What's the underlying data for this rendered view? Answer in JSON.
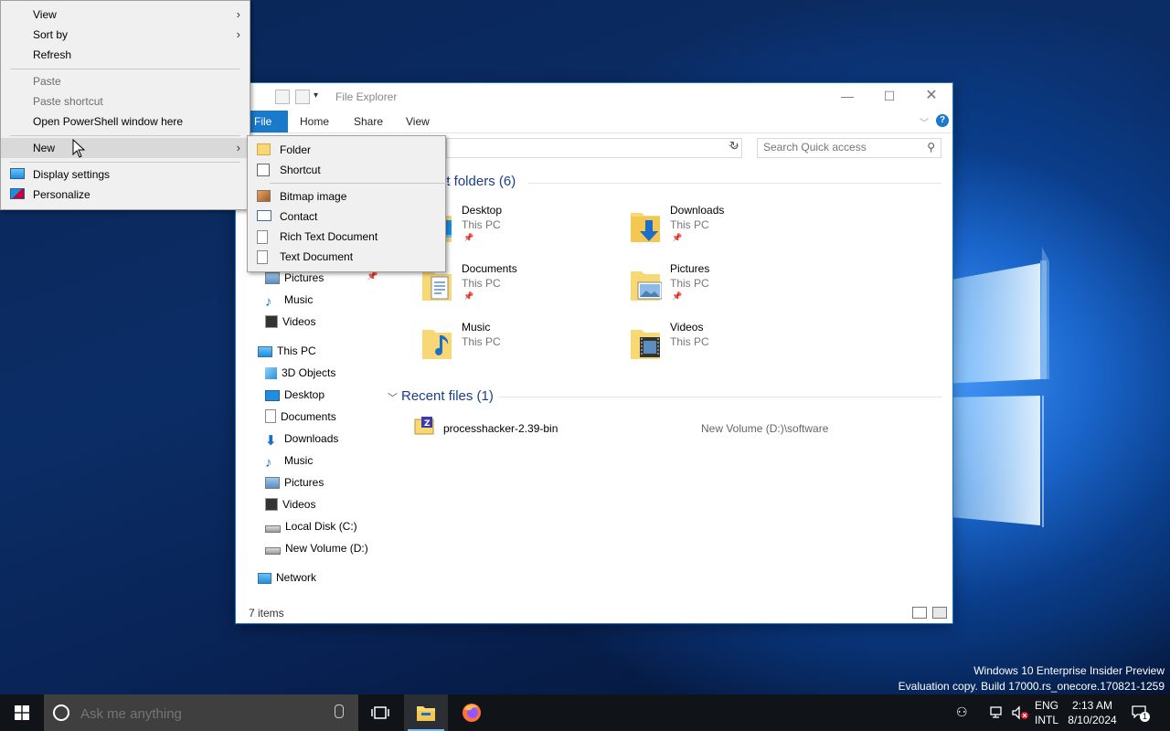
{
  "context_menu": {
    "items": [
      {
        "label": "View",
        "has_submenu": true
      },
      {
        "label": "Sort by",
        "has_submenu": true
      },
      {
        "label": "Refresh"
      },
      {
        "label": "Paste",
        "disabled": true
      },
      {
        "label": "Paste shortcut",
        "disabled": true
      },
      {
        "label": "Open PowerShell window here"
      },
      {
        "label": "New",
        "has_submenu": true,
        "highlighted": true
      },
      {
        "label": "Display settings",
        "icon": "display-settings-icon"
      },
      {
        "label": "Personalize",
        "icon": "personalize-icon"
      }
    ]
  },
  "new_submenu": {
    "items": [
      {
        "label": "Folder",
        "icon": "folder-icon"
      },
      {
        "label": "Shortcut",
        "icon": "shortcut-icon"
      },
      {
        "label": "Bitmap image",
        "icon": "bitmap-icon"
      },
      {
        "label": "Contact",
        "icon": "contact-icon"
      },
      {
        "label": "Rich Text Document",
        "icon": "rich-text-icon"
      },
      {
        "label": "Text Document",
        "icon": "text-document-icon"
      }
    ]
  },
  "explorer": {
    "title": "File Explorer",
    "tabs": [
      "File",
      "Home",
      "Share",
      "View"
    ],
    "search_placeholder": "Search Quick access",
    "sidebar": {
      "quick_access": [
        {
          "label": "Pictures",
          "icon": "pictures-icon",
          "pinned": true
        },
        {
          "label": "Music",
          "icon": "music-icon"
        },
        {
          "label": "Videos",
          "icon": "videos-icon"
        }
      ],
      "this_pc_label": "This PC",
      "this_pc_items": [
        {
          "label": "3D Objects",
          "icon": "3d-objects-icon"
        },
        {
          "label": "Desktop",
          "icon": "desktop-icon"
        },
        {
          "label": "Documents",
          "icon": "documents-icon"
        },
        {
          "label": "Downloads",
          "icon": "downloads-icon"
        },
        {
          "label": "Music",
          "icon": "music-icon"
        },
        {
          "label": "Pictures",
          "icon": "pictures-icon"
        },
        {
          "label": "Videos",
          "icon": "videos-icon"
        },
        {
          "label": "Local Disk (C:)",
          "icon": "local-disk-icon"
        },
        {
          "label": "New Volume (D:)",
          "icon": "drive-icon"
        }
      ],
      "network_label": "Network"
    },
    "frequent_header": "nt folders (6)",
    "frequent_folders": [
      {
        "name": "Desktop",
        "location": "This PC"
      },
      {
        "name": "Downloads",
        "location": "This PC"
      },
      {
        "name": "Documents",
        "location": "This PC"
      },
      {
        "name": "Pictures",
        "location": "This PC"
      },
      {
        "name": "Music",
        "location": "This PC"
      },
      {
        "name": "Videos",
        "location": "This PC"
      }
    ],
    "recent_header": "Recent files (1)",
    "recent_files": [
      {
        "name": "processhacker-2.39-bin",
        "path": "New Volume (D:)\\software"
      }
    ],
    "status": "7 items"
  },
  "watermark": {
    "line1": "Windows 10 Enterprise Insider Preview",
    "line2": "Evaluation copy. Build 17000.rs_onecore.170821-1259"
  },
  "taskbar": {
    "search_placeholder": "Ask me anything",
    "lang_top": "ENG",
    "lang_bottom": "INTL",
    "time": "2:13 AM",
    "date": "8/10/2024",
    "notification_count": "1"
  },
  "colors": {
    "accent": "#1979ca",
    "menu_bg": "#f0f0f0",
    "taskbar_bg": "#101418"
  }
}
